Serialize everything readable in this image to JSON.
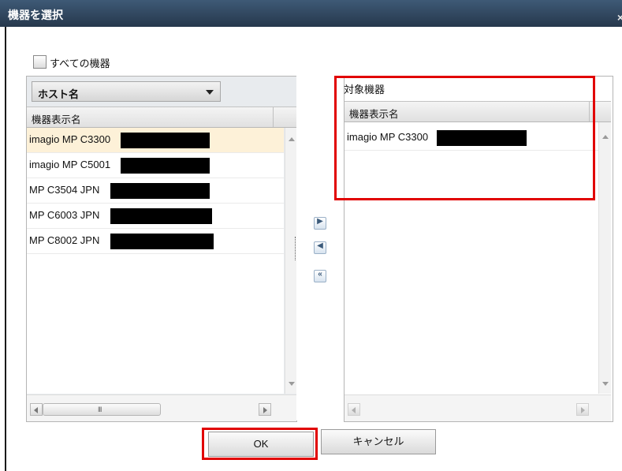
{
  "dialog": {
    "title": "機器を選択",
    "close_glyph": "×"
  },
  "all_devices": {
    "label": "すべての機器",
    "checked": false
  },
  "left_panel": {
    "dropdown_value": "ホスト名",
    "column_header": "機器表示名",
    "rows": [
      {
        "name": "imagio MP C3300",
        "selected": true
      },
      {
        "name": "imagio MP C5001",
        "selected": false
      },
      {
        "name": "MP C3504 JPN",
        "selected": false
      },
      {
        "name": "MP C6003 JPN",
        "selected": false
      },
      {
        "name": "MP C8002 JPN",
        "selected": false
      }
    ],
    "hscroll_grip": "III"
  },
  "move_buttons": {
    "add": "▶",
    "remove": "◀",
    "remove_all": "«"
  },
  "right_panel": {
    "title": "対象機器",
    "column_header": "機器表示名",
    "rows": [
      {
        "name": "imagio MP C3300"
      }
    ]
  },
  "buttons": {
    "ok": "OK",
    "cancel": "キャンセル"
  },
  "colors": {
    "highlight_red": "#e10000",
    "selected_row": "#fdf1d8",
    "titlebar": "#2f4560"
  }
}
